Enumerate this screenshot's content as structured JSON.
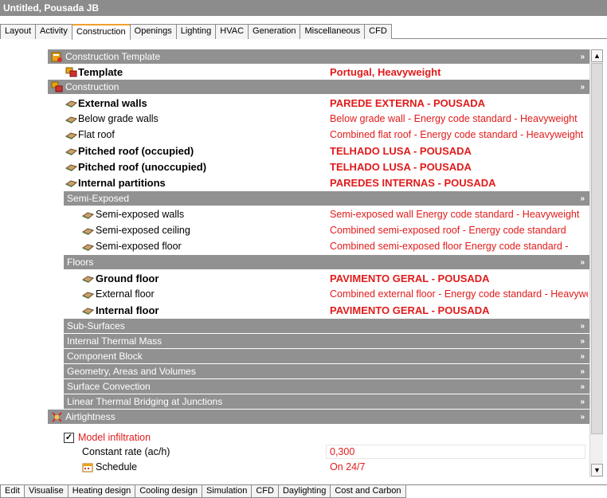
{
  "window": {
    "title": "Untitled, Pousada JB"
  },
  "top_tabs": [
    "Layout",
    "Activity",
    "Construction",
    "Openings",
    "Lighting",
    "HVAC",
    "Generation",
    "Miscellaneous",
    "CFD"
  ],
  "active_top_tab": "Construction",
  "bottom_tabs": [
    "Edit",
    "Visualise",
    "Heating design",
    "Cooling design",
    "Simulation",
    "CFD",
    "Daylighting",
    "Cost and Carbon"
  ],
  "active_bottom_tab": "Edit",
  "sections": {
    "construction_template": {
      "label": "Construction Template",
      "arrow": "»"
    },
    "template": {
      "label": "Template",
      "value": "Portugal, Heavyweight"
    },
    "construction": {
      "label": "Construction",
      "arrow": "»"
    },
    "external_walls": {
      "label": "External walls",
      "value": "PAREDE EXTERNA - POUSADA"
    },
    "below_grade_walls": {
      "label": "Below grade walls",
      "value": "Below grade wall - Energy code standard - Heavyweight"
    },
    "flat_roof": {
      "label": "Flat roof",
      "value": "Combined flat roof - Energy code standard - Heavyweight"
    },
    "pitched_roof_occupied": {
      "label": "Pitched roof (occupied)",
      "value": "TELHADO LUSA - POUSADA"
    },
    "pitched_roof_unoccupied": {
      "label": "Pitched roof (unoccupied)",
      "value": "TELHADO LUSA - POUSADA"
    },
    "internal_partitions": {
      "label": "Internal partitions",
      "value": "PAREDES INTERNAS - POUSADA"
    },
    "semi_exposed": {
      "label": "Semi-Exposed",
      "arrow": "»"
    },
    "semi_exposed_walls": {
      "label": "Semi-exposed walls",
      "value": "Semi-exposed wall Energy code standard - Heavyweight"
    },
    "semi_exposed_ceiling": {
      "label": "Semi-exposed ceiling",
      "value": "Combined semi-exposed roof - Energy code standard"
    },
    "semi_exposed_floor": {
      "label": "Semi-exposed floor",
      "value": "Combined semi-exposed floor Energy code standard - "
    },
    "floors": {
      "label": "Floors",
      "arrow": "»"
    },
    "ground_floor": {
      "label": "Ground floor",
      "value": "PAVIMENTO GERAL - POUSADA"
    },
    "external_floor": {
      "label": "External floor",
      "value": "Combined external floor - Energy code standard - Heavyweight"
    },
    "internal_floor": {
      "label": "Internal floor",
      "value": "PAVIMENTO GERAL - POUSADA"
    },
    "sub_surfaces": {
      "label": "Sub-Surfaces",
      "arrow": "»"
    },
    "internal_thermal_mass": {
      "label": "Internal Thermal Mass",
      "arrow": "»"
    },
    "component_block": {
      "label": "Component Block",
      "arrow": "»"
    },
    "geometry": {
      "label": "Geometry, Areas and Volumes",
      "arrow": "»"
    },
    "surface_convection": {
      "label": "Surface Convection",
      "arrow": "»"
    },
    "linear_thermal_bridging": {
      "label": "Linear Thermal Bridging at Junctions",
      "arrow": "»"
    },
    "airtightness": {
      "label": "Airtightness",
      "arrow": "»"
    },
    "model_infiltration": {
      "label": "Model infiltration",
      "checked": true,
      "check_glyph": "✓"
    },
    "constant_rate": {
      "label": "Constant rate (ac/h)",
      "value": "0,300"
    },
    "schedule": {
      "label": "Schedule",
      "value": "On 24/7"
    }
  },
  "scrollbar": {
    "up": "▲",
    "down": "▼"
  },
  "colors": {
    "header_bg": "#919191",
    "value_red": "#e11b1b",
    "titlebar_bg": "#8c8c8c"
  }
}
